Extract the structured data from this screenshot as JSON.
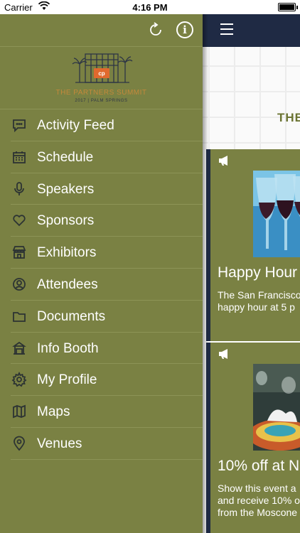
{
  "status_bar": {
    "carrier": "Carrier",
    "time": "4:16 PM"
  },
  "logo": {
    "title": "THE PARTNERS SUMMIT",
    "subtitle": "2017  |  PALM SPRINGS"
  },
  "menu": [
    {
      "label": "Activity Feed",
      "icon": "activity-feed-icon"
    },
    {
      "label": "Schedule",
      "icon": "calendar-icon"
    },
    {
      "label": "Speakers",
      "icon": "microphone-icon"
    },
    {
      "label": "Sponsors",
      "icon": "heart-icon"
    },
    {
      "label": "Exhibitors",
      "icon": "storefront-icon"
    },
    {
      "label": "Attendees",
      "icon": "person-icon"
    },
    {
      "label": "Documents",
      "icon": "folder-icon"
    },
    {
      "label": "Info Booth",
      "icon": "booth-icon"
    },
    {
      "label": "My Profile",
      "icon": "gear-icon"
    },
    {
      "label": "Maps",
      "icon": "map-icon"
    },
    {
      "label": "Venues",
      "icon": "location-pin-icon"
    }
  ],
  "main": {
    "banner_text": "THE",
    "cards": [
      {
        "title": "Happy Hour",
        "body_line1": "The San Francisco",
        "body_line2": "happy hour at 5 p"
      },
      {
        "title": "10% off at N",
        "body_line1": "Show this event a",
        "body_line2": "and receive 10% o",
        "body_line3": "from the Moscone"
      }
    ]
  },
  "colors": {
    "drawer": "#7a8143",
    "nav": "#1f2a44",
    "accent": "#c4893b"
  }
}
